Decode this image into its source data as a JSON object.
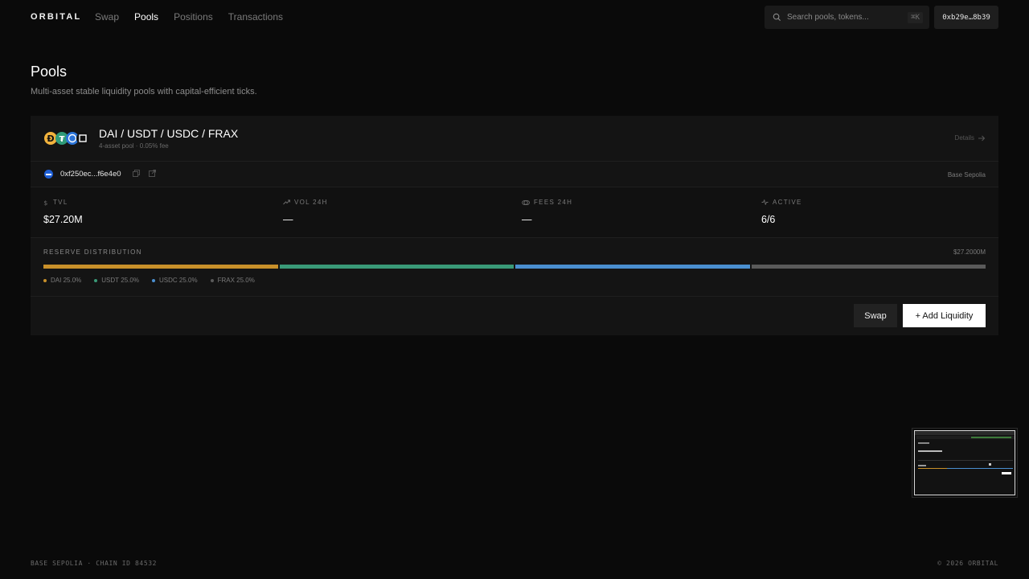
{
  "header": {
    "brand": "ORBITAL",
    "nav": [
      {
        "label": "Swap",
        "active": false
      },
      {
        "label": "Pools",
        "active": true
      },
      {
        "label": "Positions",
        "active": false
      },
      {
        "label": "Transactions",
        "active": false
      }
    ],
    "search": {
      "placeholder": "Search pools, tokens...",
      "shortcut": "⌘K"
    },
    "wallet": "0xb29e…8b39"
  },
  "page": {
    "title": "Pools",
    "subtitle": "Multi-asset stable liquidity pools with capital-efficient ticks."
  },
  "pool": {
    "name": "DAI / USDT / USDC / FRAX",
    "meta": "4-asset pool · 0.05% fee",
    "details_label": "Details",
    "address": "0xf250ec...f6e4e0",
    "network": "Base Sepolia",
    "stats": [
      {
        "label": "TVL",
        "value": "$27.20M",
        "icon": "dollar-icon"
      },
      {
        "label": "VOL 24H",
        "value": "—",
        "icon": "trend-up-icon"
      },
      {
        "label": "FEES 24H",
        "value": "—",
        "icon": "coins-icon"
      },
      {
        "label": "ACTIVE",
        "value": "6/6",
        "icon": "activity-icon"
      }
    ],
    "reserve": {
      "label": "RESERVE DISTRIBUTION",
      "total": "$27.2000M",
      "assets": [
        {
          "symbol": "DAI",
          "share": "25.0%",
          "fraction": 0.25,
          "color": "#c8902a"
        },
        {
          "symbol": "USDT",
          "share": "25.0%",
          "fraction": 0.25,
          "color": "#3a9a78"
        },
        {
          "symbol": "USDC",
          "share": "25.0%",
          "fraction": 0.25,
          "color": "#4a8fd0"
        },
        {
          "symbol": "FRAX",
          "share": "25.0%",
          "fraction": 0.25,
          "color": "#5a5a5a"
        }
      ]
    },
    "actions": {
      "swap": "Swap",
      "add": "+ Add Liquidity"
    }
  },
  "footer": {
    "left": "BASE SEPOLIA · CHAIN ID 84532",
    "right": "© 2026 ORBITAL"
  }
}
